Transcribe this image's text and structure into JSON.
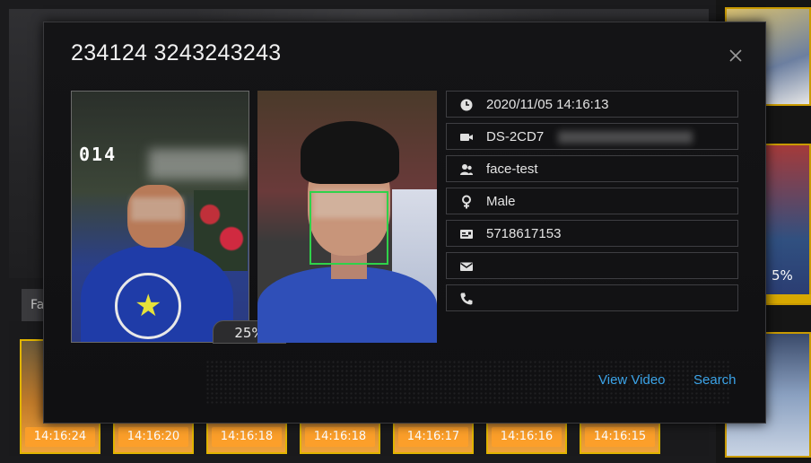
{
  "background": {
    "tab_label": "Fa",
    "thumbnails": [
      {
        "time": "14:16:24"
      },
      {
        "time": "14:16:20"
      },
      {
        "time": "14:16:18"
      },
      {
        "time": "14:16:18"
      },
      {
        "time": "14:16:17"
      },
      {
        "time": "14:16:16"
      },
      {
        "time": "14:16:15"
      }
    ],
    "side_match_percent": "5%"
  },
  "dialog": {
    "title": "234124 3243243243",
    "similarity": "25%",
    "details": {
      "time": "2020/11/05 14:16:13",
      "camera": "DS-2CD7",
      "group": "face-test",
      "gender": "Male",
      "id_number": "5718617153",
      "email": "",
      "phone": ""
    },
    "snapshot_overlay_text": "014",
    "links": {
      "view_video": "View Video",
      "search": "Search"
    }
  },
  "colors": {
    "accent_link": "#3aa3e8",
    "face_box": "#2fd24a",
    "thumbnail_border": "#e1b400"
  }
}
